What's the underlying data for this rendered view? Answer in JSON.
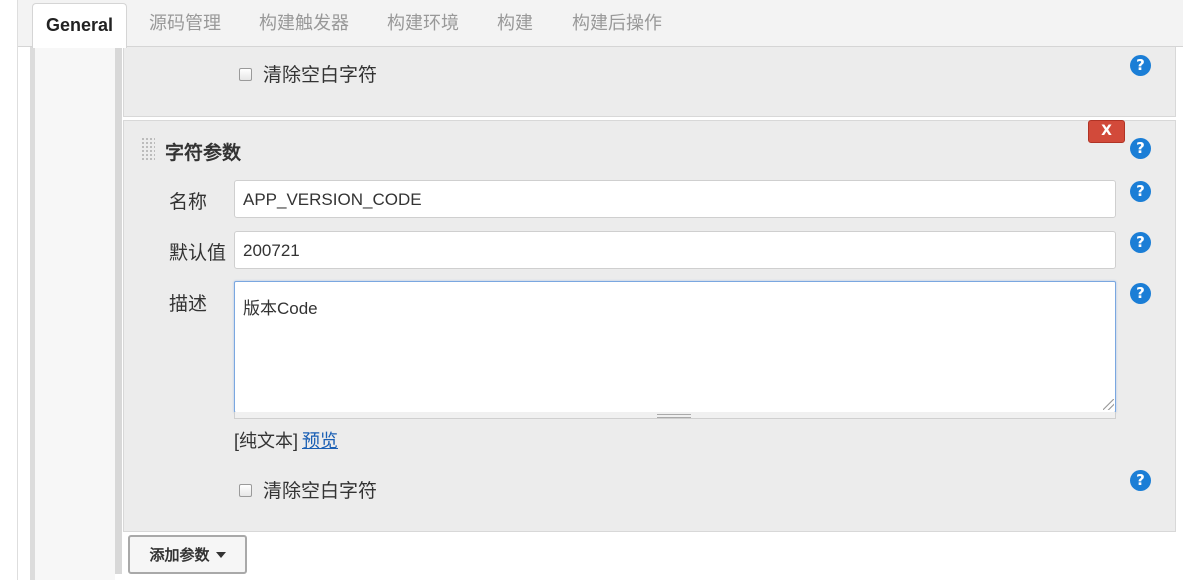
{
  "tabs": [
    {
      "label": "General",
      "active": true
    },
    {
      "label": "源码管理"
    },
    {
      "label": "构建触发器"
    },
    {
      "label": "构建环境"
    },
    {
      "label": "构建"
    },
    {
      "label": "构建后操作"
    }
  ],
  "prev_param": {
    "trim_label": "清除空白字符",
    "trim_checked": false
  },
  "string_param": {
    "title": "字符参数",
    "delete_label": "X",
    "name_label": "名称",
    "name_value": "APP_VERSION_CODE",
    "default_label": "默认值",
    "default_value": "200721",
    "desc_label": "描述",
    "desc_value": "版本Code",
    "format_text": "[纯文本]",
    "preview_link": "预览",
    "trim_label": "清除空白字符",
    "trim_checked": false
  },
  "help_icon_glyph": "?",
  "add_button_label": "添加参数",
  "colors": {
    "help_blue": "#1b7ed6",
    "delete_red": "#d24a3a",
    "link_blue": "#1a5fb4"
  }
}
